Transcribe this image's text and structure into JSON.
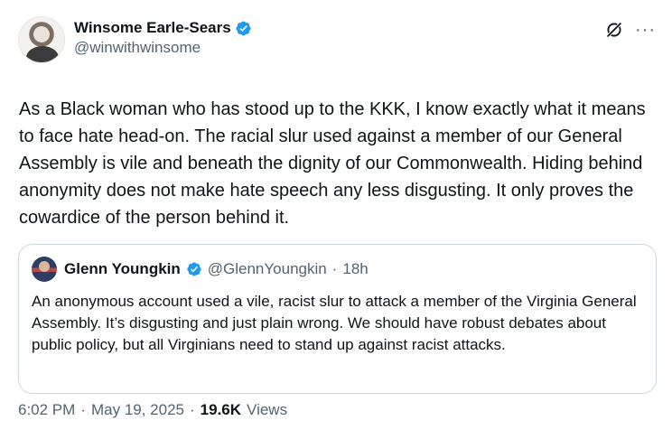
{
  "author": {
    "display_name": "Winsome Earle-Sears",
    "handle": "@winwithwinsome",
    "verified": true
  },
  "body": "As a Black woman who has stood up to the KKK, I know exactly what it means to face hate head-on. The racial slur used against a member of our General Assembly is vile and beneath the dignity of our Commonwealth. Hiding behind anonymity does not make hate speech any less disgusting. It only proves the cowardice of the person behind it.",
  "quote": {
    "display_name": "Glenn Youngkin",
    "handle": "@GlennYoungkin",
    "separator": "·",
    "time": "18h",
    "text": "An anonymous account used a vile, racist slur to attack a member of the Virginia General Assembly. It’s disgusting and just plain wrong. We should have robust debates about public policy, but all Virginians need to stand up against racist attacks."
  },
  "footer": {
    "time": "6:02 PM",
    "sep1": "·",
    "date": "May 19, 2025",
    "sep2": "·",
    "views_count": "19.6K",
    "views_label": "Views"
  },
  "colors": {
    "verified": "#1d9bf0",
    "text": "#0f1419",
    "secondary": "#536471",
    "border": "#cfd9de"
  },
  "icons": {
    "grok": "grok-icon",
    "more": "more-icon"
  }
}
